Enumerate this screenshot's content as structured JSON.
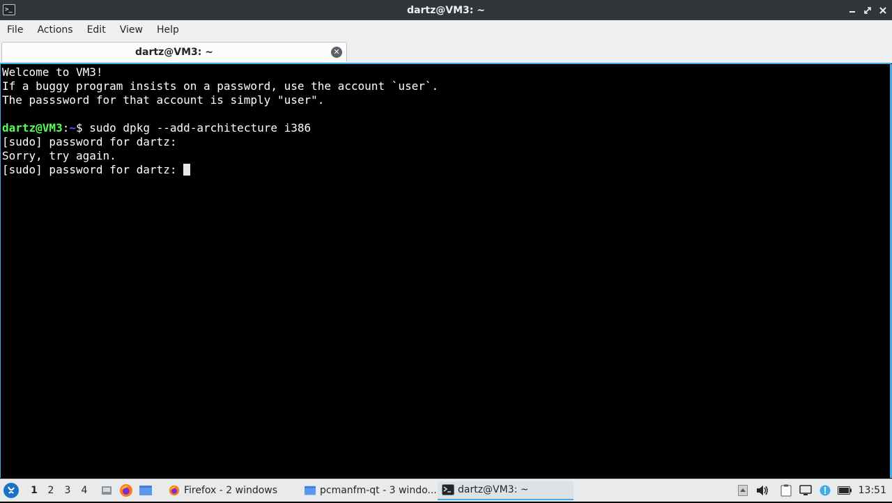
{
  "window": {
    "title": "dartz@VM3: ~"
  },
  "menu": {
    "items": [
      "File",
      "Actions",
      "Edit",
      "View",
      "Help"
    ]
  },
  "tabs": [
    {
      "label": "dartz@VM3: ~"
    }
  ],
  "terminal": {
    "lines": [
      "Welcome to VM3!",
      "If a buggy program insists on a password, use the account `user`.",
      "The passsword for that account is simply \"user\".",
      "",
      "",
      "[sudo] password for dartz:",
      "Sorry, try again.",
      "[sudo] password for dartz: "
    ],
    "prompt_user": "dartz@VM3",
    "prompt_sep": ":",
    "prompt_path": "~",
    "prompt_symbol": "$",
    "command": " sudo dpkg --add-architecture i386"
  },
  "taskbar": {
    "desktops": [
      "1",
      "2",
      "3",
      "4"
    ],
    "tasks": [
      {
        "label": "Firefox - 2 windows"
      },
      {
        "label": "pcmanfm-qt - 3 windo..."
      },
      {
        "label": "dartz@VM3: ~"
      }
    ],
    "clock": "13:51"
  },
  "colors": {
    "accent": "#3daee9",
    "prompt_user": "#54ff54",
    "prompt_path": "#5454ff"
  }
}
